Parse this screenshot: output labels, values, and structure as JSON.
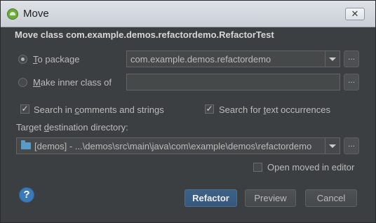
{
  "window": {
    "title": "Move"
  },
  "header": {
    "text": "Move class com.example.demos.refactordemo.RefactorTest"
  },
  "to_package": {
    "label_prefix": "",
    "label_mnemonic": "T",
    "label_rest": "o package",
    "selected": true,
    "value": "com.example.demos.refactordemo",
    "browse_label": "..."
  },
  "inner_class": {
    "label_mnemonic": "M",
    "label_rest": "ake inner class of",
    "selected": false,
    "value": "",
    "browse_label": "..."
  },
  "options": {
    "search_comments": {
      "label_prefix": "Search in ",
      "label_mnemonic": "c",
      "label_rest": "omments and strings",
      "checked": true
    },
    "search_text": {
      "label_prefix": "Search for ",
      "label_mnemonic": "t",
      "label_rest": "ext occurrences",
      "checked": true
    }
  },
  "target": {
    "label_prefix": "Target ",
    "label_mnemonic": "d",
    "label_rest": "estination directory:",
    "value": "[demos] - ...\\demos\\src\\main\\java\\com\\example\\demos\\refactordemo",
    "browse_label": "...",
    "icon": "folder-icon"
  },
  "open_in_editor": {
    "label": "Open moved in editor",
    "checked": false
  },
  "footer": {
    "help_label": "?",
    "refactor_label": "Refactor",
    "preview_label": "Preview",
    "cancel_label": "Cancel"
  },
  "colors": {
    "background": "#3c3f41",
    "primary_button": "#365880",
    "help": "#3b7ab8"
  }
}
